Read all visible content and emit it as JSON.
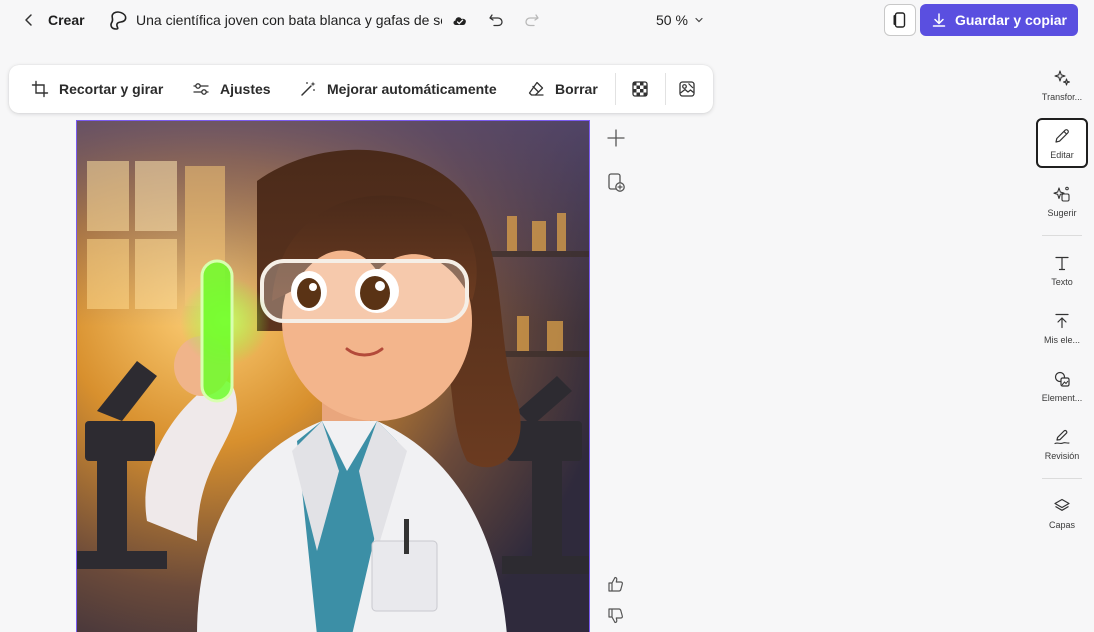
{
  "header": {
    "back_label": "Crear",
    "document_title": "Una científica joven con bata blanca y gafas de se",
    "zoom_level": "50 %",
    "primary_action_label": "Guardar y copiar"
  },
  "edit_toolbar": {
    "crop_label": "Recortar y girar",
    "adjust_label": "Ajustes",
    "enhance_label": "Mejorar automáticamente",
    "erase_label": "Borrar"
  },
  "right_rail": {
    "transform_label": "Transfor...",
    "edit_label": "Editar",
    "suggest_label": "Sugerir",
    "text_label": "Texto",
    "my_elements_label": "Mis ele...",
    "elements_label": "Element...",
    "review_label": "Revisión",
    "layers_label": "Capas"
  },
  "colors": {
    "accent": "#5a4fe0",
    "canvas_border": "#7b5cf0"
  }
}
